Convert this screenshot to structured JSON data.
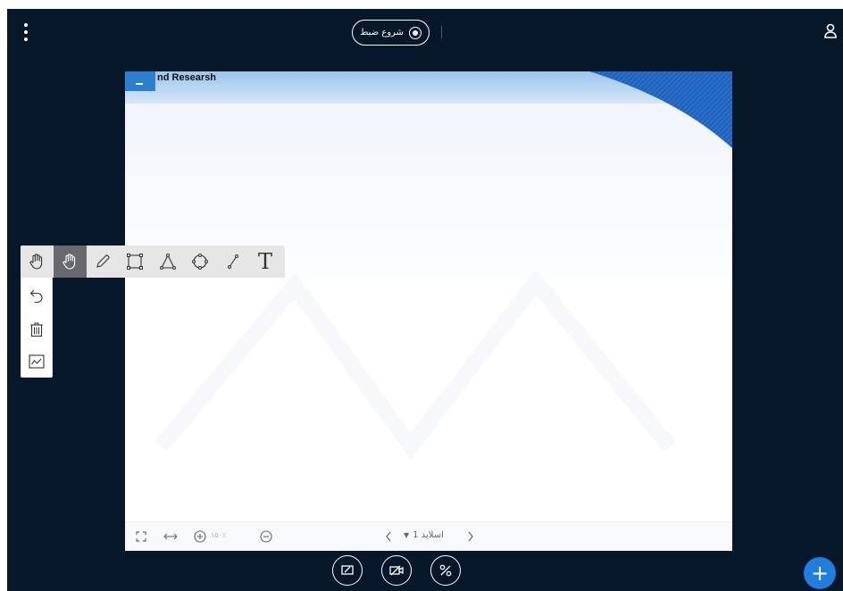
{
  "header": {
    "record_label": "شروع ضبط",
    "menu_icon": "kebab-menu-icon",
    "user_icon": "user-icon"
  },
  "presentation": {
    "slide_title": "nd Researsh",
    "zoom_level": "۱۵۰٪",
    "slide_label": "اسلاید 1"
  },
  "colors": {
    "background": "#06172a",
    "accent": "#1e7fe0"
  },
  "tools": [
    "hand-icon",
    "pencil-icon",
    "rectangle-icon",
    "triangle-icon",
    "ellipse-icon",
    "line-icon",
    "text-icon",
    "undo-icon",
    "trash-icon",
    "multi-user-whiteboard-icon"
  ],
  "text_tool_glyph": "T",
  "actions": [
    "share-screen-icon",
    "camera-off-icon",
    "audio-off-icon"
  ],
  "fab": "+"
}
